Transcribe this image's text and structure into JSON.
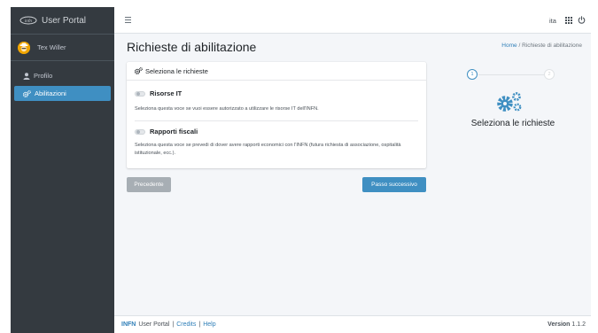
{
  "app": {
    "title": "User Portal",
    "logo_icon": "infn-logo-icon"
  },
  "sidebar": {
    "user": {
      "name": "Tex Willer",
      "avatar_icon": "user-avatar-icon"
    },
    "items": [
      {
        "label": "Profilo",
        "icon": "user-icon",
        "active": false
      },
      {
        "label": "Abilitazioni",
        "icon": "cogs-icon",
        "active": true
      }
    ]
  },
  "topbar": {
    "lang": "ita",
    "menu_icon": "hamburger-icon",
    "apps_icon": "grid-icon",
    "power_icon": "power-icon"
  },
  "page": {
    "title": "Richieste di abilitazione",
    "breadcrumb": {
      "home": "Home",
      "separator": "/",
      "current": "Richieste di abilitazione"
    }
  },
  "card": {
    "header": "Seleziona le richieste",
    "options": [
      {
        "title": "Risorse IT",
        "description": "Seleziona questa voce se vuoi essere autorizzato a utilizzare le risorse IT dell'INFN.",
        "checked": false
      },
      {
        "title": "Rapporti fiscali",
        "description": "Seleziona questa voce se prevedi di dover avere rapporti economici con l'INFN (futura richiesta di associazione, ospitalità istituzionale, ecc.).",
        "checked": false
      }
    ]
  },
  "buttons": {
    "prev": "Precedente",
    "next": "Passo successivo"
  },
  "stepper": {
    "steps": [
      "1",
      "2"
    ],
    "current": 1,
    "label": "Seleziona le richieste"
  },
  "footer": {
    "brand": "INFN",
    "portal": "User Portal",
    "sep": "|",
    "credits": "Credits",
    "help": "Help",
    "version_label": "Version",
    "version": "1.1.2"
  },
  "colors": {
    "sidebar_bg": "#343a40",
    "accent": "#3f8fc2",
    "content_bg": "#f4f6f9"
  }
}
